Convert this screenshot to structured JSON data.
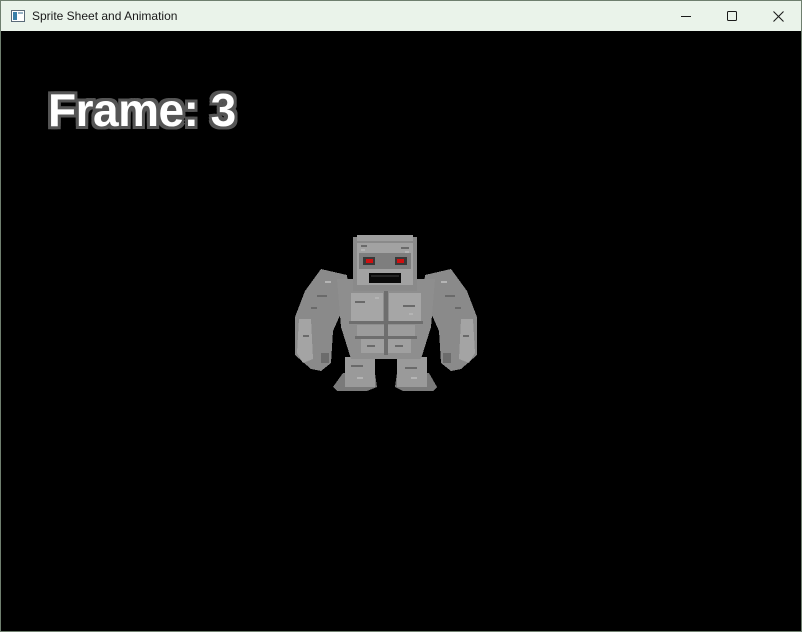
{
  "window": {
    "title": "Sprite Sheet and Animation",
    "icon": "app-window-icon",
    "controls": {
      "minimize_icon": "minimize-icon",
      "maximize_icon": "maximize-icon",
      "close_icon": "close-icon"
    }
  },
  "game": {
    "background_color": "#000000",
    "frame_text": "Frame: 3",
    "frame_text_color": "#ffffff",
    "frame_outline_color": "#555555",
    "sprite": {
      "name": "stone-golem-sprite",
      "body_color": "#8c8c8c",
      "eye_color": "#d01010"
    }
  }
}
